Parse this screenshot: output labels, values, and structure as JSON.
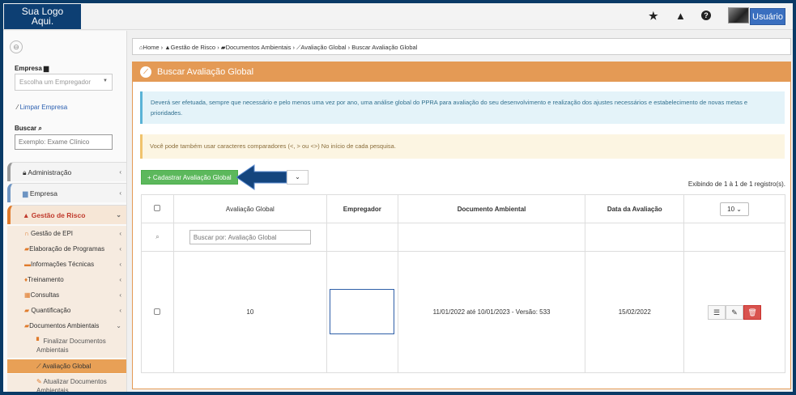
{
  "logo": {
    "line1": "Sua Logo",
    "line2": "Aqui."
  },
  "topbar": {
    "user_label": "Usuário",
    "star": "★",
    "warn": "▲",
    "help": "?"
  },
  "sidebar": {
    "collapse_icon": "⊖",
    "empresa_label": "Empresa",
    "empresa_placeholder": "Escolha um Empregador",
    "clear_label": "Limpar Empresa",
    "search_label": "Buscar",
    "search_placeholder": "Exemplo: Exame Clínico",
    "menu": [
      {
        "label": "Administração"
      },
      {
        "label": "Empresa"
      },
      {
        "label": "Gestão de Risco"
      }
    ],
    "submenu": [
      {
        "label": "Gestão de EPI"
      },
      {
        "label": "Elaboração de Programas"
      },
      {
        "label": "Informações Técnicas"
      },
      {
        "label": "Treinamento"
      },
      {
        "label": "Consultas"
      },
      {
        "label": "Quantificação"
      },
      {
        "label": "Documentos Ambientais"
      }
    ],
    "subsub": [
      {
        "label": "Finalizar Documentos Ambientais"
      },
      {
        "label": "Avaliação Global"
      },
      {
        "label": "Atualizar Documentos Ambientais"
      }
    ]
  },
  "breadcrumb": {
    "home": "Home",
    "risk": "Gestão de Risco",
    "docs": "Documentos Ambientais",
    "global": "Avaliação Global",
    "current": "Buscar Avaliação Global"
  },
  "panel": {
    "title": "Buscar Avaliação Global",
    "info_text": "Deverá ser efetuada, sempre que necessário e pelo menos uma vez por ano, uma análise global do PPRA para avaliação do seu desenvolvimento e realização dos ajustes necessários e estabelecimento de novas metas e prioridades.",
    "warn_text": "Você pode também usar caracteres comparadores (<, > ou <>) No início de cada pesquisa.",
    "add_button": "Cadastrar Avaliação Global",
    "count_text": "Exibindo de 1 à 1 de 1 registro(s)."
  },
  "table": {
    "headers": [
      "Avaliação Global",
      "Empregador",
      "Documento Ambiental",
      "Data da Avaliação"
    ],
    "per_page": "10",
    "search_placeholder": "Buscar por: Avaliação Global",
    "rows": [
      {
        "avaliacao": "10",
        "empregador": "",
        "documento": "11/01/2022 até 10/01/2023 - Versão: 533",
        "data": "15/02/2022"
      }
    ]
  },
  "colors": {
    "accent": "#e49a55",
    "logo_bg": "#0d3f73",
    "add_green": "#5cb85c",
    "delete_red": "#d9534f",
    "arrow_blue": "#14457e"
  }
}
